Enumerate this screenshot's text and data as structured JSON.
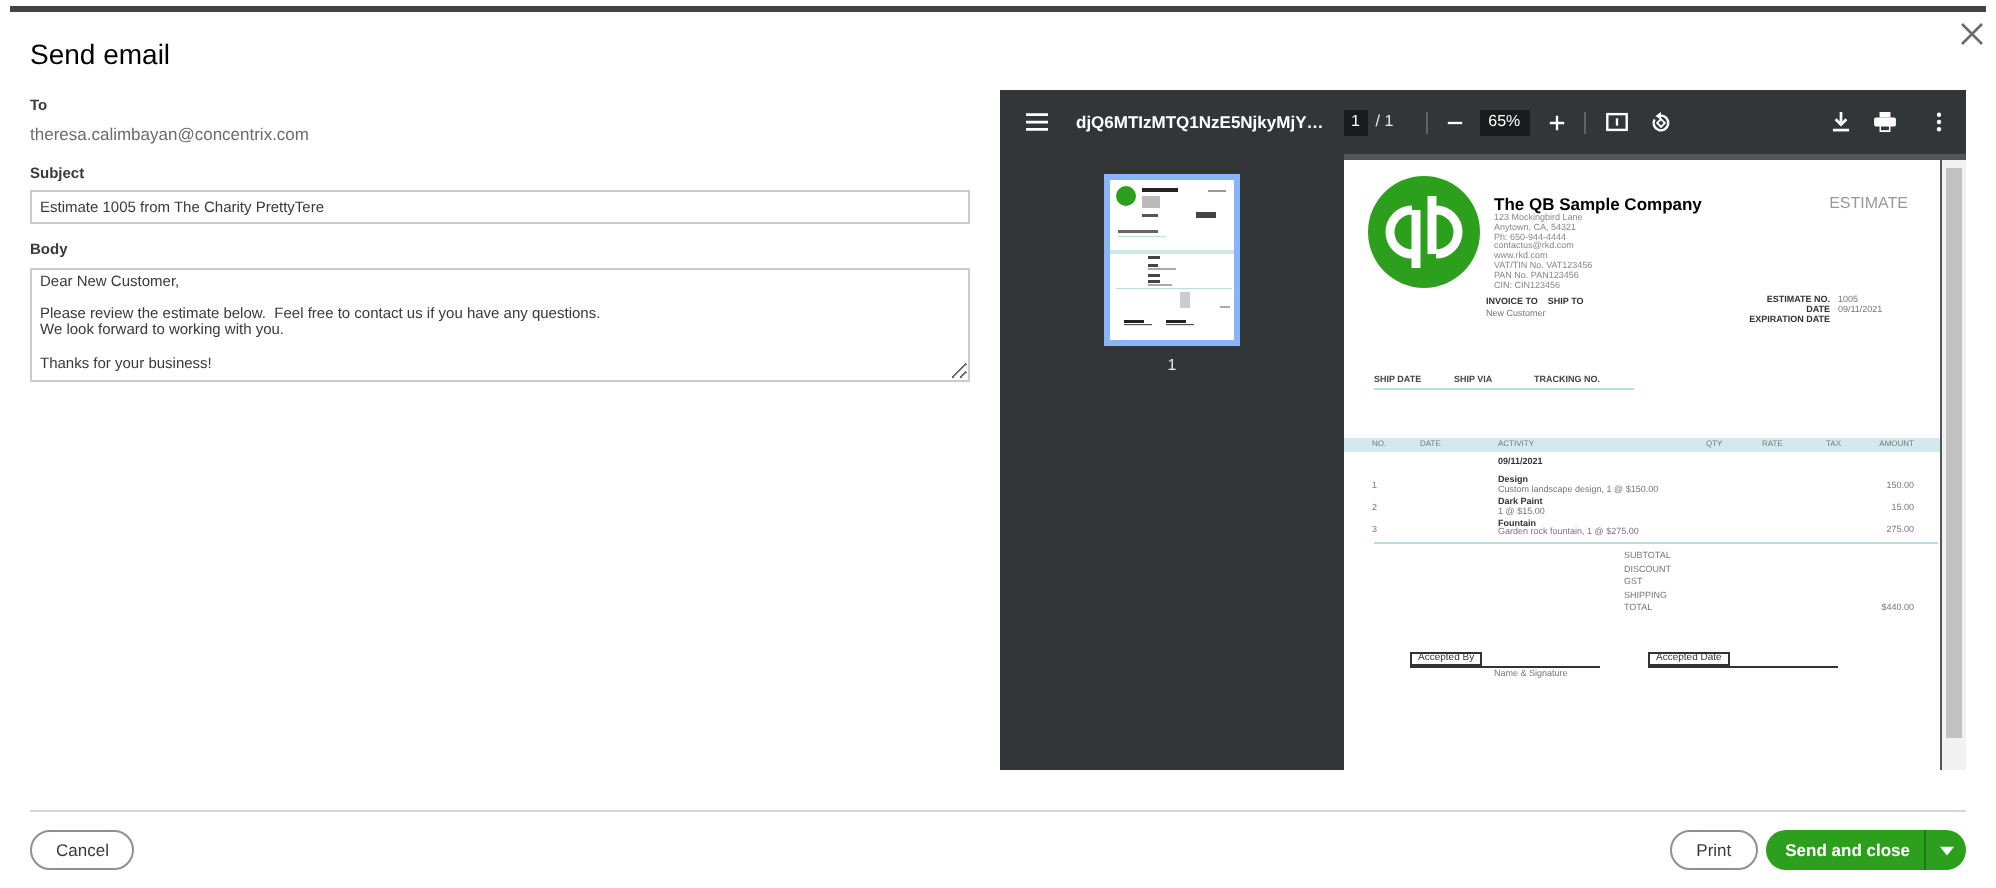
{
  "dialog": {
    "title": "Send email"
  },
  "form": {
    "to_label": "To",
    "to": "theresa.calimbayan@concentrix.com",
    "subject_label": "Subject",
    "subject": "Estimate 1005 from The Charity PrettyTere",
    "body_label": "Body",
    "body": "Dear New Customer,\n\nPlease review the estimate below.  Feel free to contact us if you have any questions.\nWe look forward to working with you.\n\nThanks for your business!"
  },
  "pdf_viewer": {
    "filename": "djQ6MTIzMTQ1NzE5NjkyMjY…",
    "page": "1",
    "page_total": "/ 1",
    "zoom": "65%",
    "thumbnail_label": "1"
  },
  "document": {
    "company_name": "The QB Sample Company",
    "address_lines": [
      "123 Mockingbird Lane",
      "Anytown, CA, 54321",
      "Ph: 650-944-4444",
      "contactus@rkd.com",
      "www.rkd.com",
      "VAT/TIN No. VAT123456",
      "PAN No. PAN123456",
      "CIN: CIN123456"
    ],
    "doc_title": "ESTIMATE",
    "bill_headings": [
      "INVOICE TO",
      "SHIP TO"
    ],
    "customer": "New Customer",
    "meta": [
      {
        "label": "ESTIMATE NO.",
        "value": "1005"
      },
      {
        "label": "DATE",
        "value": "09/11/2021"
      },
      {
        "label": "EXPIRATION DATE"
      }
    ],
    "ship_columns": [
      "SHIP DATE",
      "SHIP VIA",
      "TRACKING NO."
    ],
    "columns": [
      "NO.",
      "DATE",
      "ACTIVITY",
      "QTY",
      "RATE",
      "TAX",
      "AMOUNT"
    ],
    "date_group": "09/11/2021",
    "items": [
      {
        "no": "1",
        "activity": "Design",
        "description": "Custom landscape design, 1 @ $150.00",
        "amount": "150.00"
      },
      {
        "no": "2",
        "activity": "Dark Paint",
        "description": "1 @ $15.00",
        "amount": "15.00"
      },
      {
        "no": "3",
        "activity": "Fountain",
        "description": "Garden rock fountain, 1 @ $275.00",
        "amount": "275.00"
      }
    ],
    "totals": [
      {
        "label": "SUBTOTAL"
      },
      {
        "label": "DISCOUNT"
      },
      {
        "label": "GST"
      },
      {
        "label": "SHIPPING"
      },
      {
        "label": "TOTAL",
        "value": "$440.00"
      }
    ],
    "signatures": [
      {
        "label": "Accepted By",
        "caption": "Name & Signature"
      },
      {
        "label": "Accepted Date"
      }
    ]
  },
  "buttons": [
    {
      "label": "Cancel",
      "kind": "secondary"
    },
    {
      "label": "Print",
      "kind": "secondary"
    },
    {
      "label": "Send and close",
      "kind": "primary"
    }
  ]
}
